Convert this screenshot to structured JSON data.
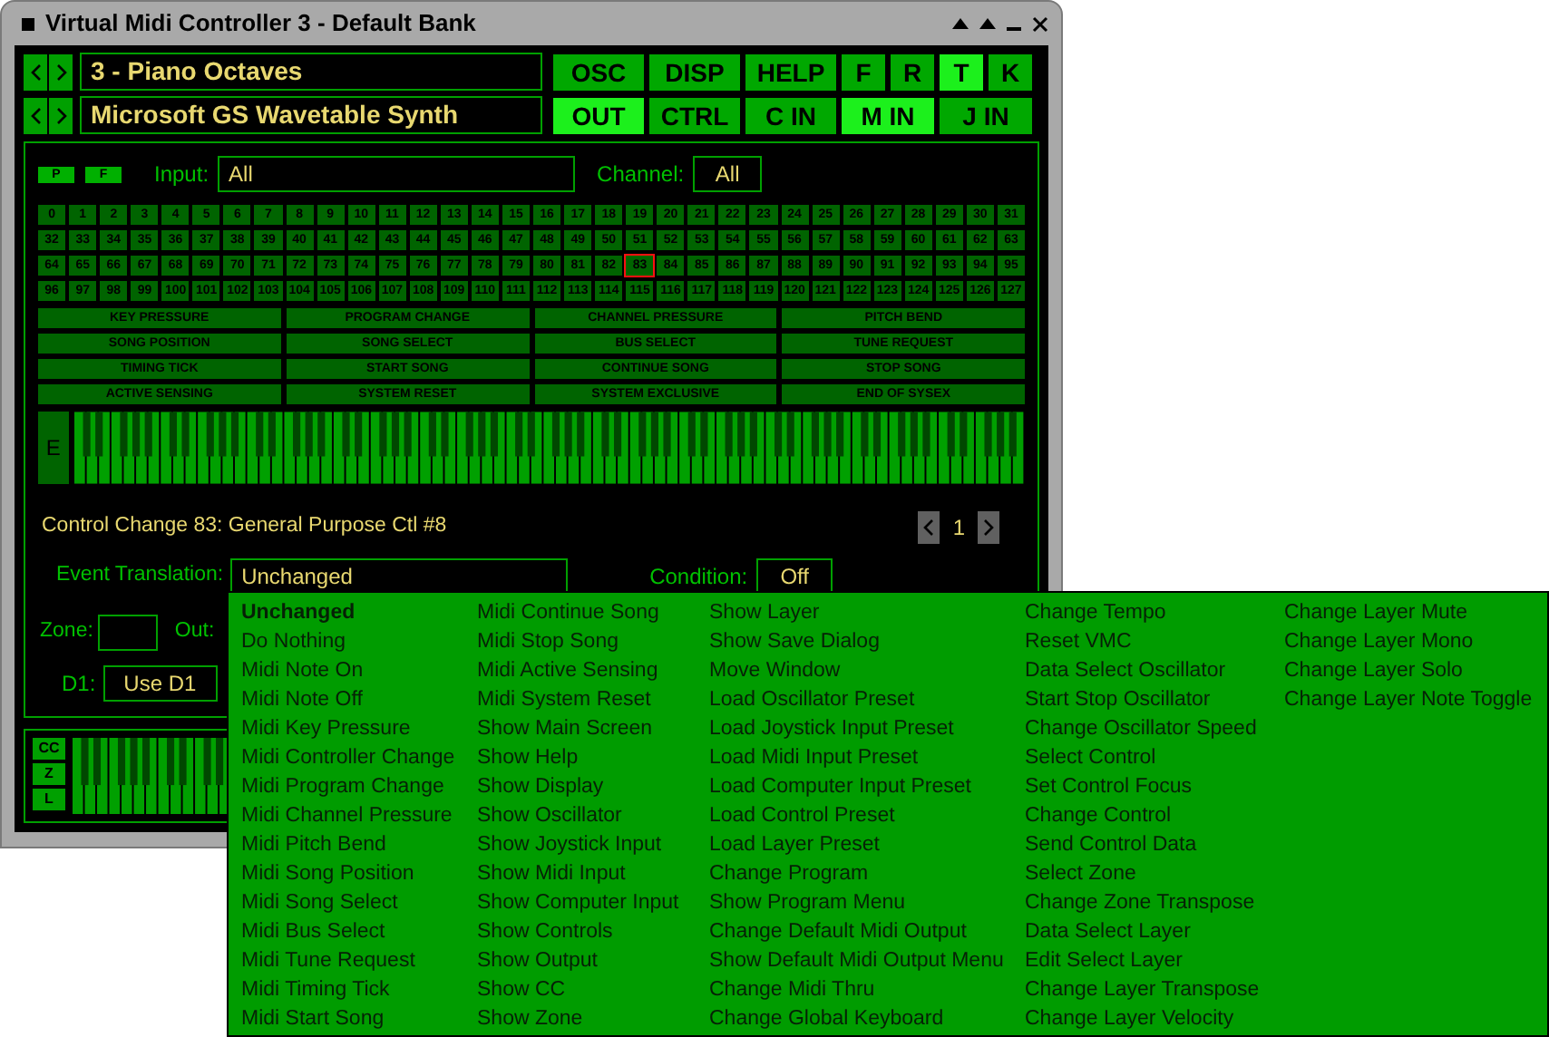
{
  "window": {
    "title": "Virtual Midi Controller 3 - Default Bank"
  },
  "selector_rows": [
    {
      "value": "3 - Piano Octaves",
      "buttons": [
        {
          "label": "OSC",
          "selected": false
        },
        {
          "label": "DISP",
          "selected": false
        },
        {
          "label": "HELP",
          "selected": false
        },
        {
          "label": "F",
          "selected": false
        },
        {
          "label": "R",
          "selected": false
        },
        {
          "label": "T",
          "selected": true
        },
        {
          "label": "K",
          "selected": false
        }
      ]
    },
    {
      "value": "Microsoft GS Wavetable Synth",
      "buttons": [
        {
          "label": "OUT",
          "selected": true
        },
        {
          "label": "CTRL",
          "selected": false
        },
        {
          "label": "C IN",
          "selected": false
        },
        {
          "label": "M IN",
          "selected": true
        },
        {
          "label": "J IN",
          "selected": false
        }
      ]
    }
  ],
  "filter": {
    "toggles": [
      "P",
      "F"
    ],
    "input_label": "Input:",
    "input_value": "All",
    "channel_label": "Channel:",
    "channel_value": "All"
  },
  "cc_buttons": [
    {
      "label": "0",
      "selected": false
    },
    {
      "label": "1",
      "selected": false
    },
    {
      "label": "2",
      "selected": false
    },
    {
      "label": "3",
      "selected": false
    },
    {
      "label": "4",
      "selected": false
    },
    {
      "label": "5",
      "selected": false
    },
    {
      "label": "6",
      "selected": false
    },
    {
      "label": "7",
      "selected": false
    },
    {
      "label": "8",
      "selected": false
    },
    {
      "label": "9",
      "selected": false
    },
    {
      "label": "10",
      "selected": false
    },
    {
      "label": "11",
      "selected": false
    },
    {
      "label": "12",
      "selected": false
    },
    {
      "label": "13",
      "selected": false
    },
    {
      "label": "14",
      "selected": false
    },
    {
      "label": "15",
      "selected": false
    },
    {
      "label": "16",
      "selected": false
    },
    {
      "label": "17",
      "selected": false
    },
    {
      "label": "18",
      "selected": false
    },
    {
      "label": "19",
      "selected": false
    },
    {
      "label": "20",
      "selected": false
    },
    {
      "label": "21",
      "selected": false
    },
    {
      "label": "22",
      "selected": false
    },
    {
      "label": "23",
      "selected": false
    },
    {
      "label": "24",
      "selected": false
    },
    {
      "label": "25",
      "selected": false
    },
    {
      "label": "26",
      "selected": false
    },
    {
      "label": "27",
      "selected": false
    },
    {
      "label": "28",
      "selected": false
    },
    {
      "label": "29",
      "selected": false
    },
    {
      "label": "30",
      "selected": false
    },
    {
      "label": "31",
      "selected": false
    },
    {
      "label": "32",
      "selected": false
    },
    {
      "label": "33",
      "selected": false
    },
    {
      "label": "34",
      "selected": false
    },
    {
      "label": "35",
      "selected": false
    },
    {
      "label": "36",
      "selected": false
    },
    {
      "label": "37",
      "selected": false
    },
    {
      "label": "38",
      "selected": false
    },
    {
      "label": "39",
      "selected": false
    },
    {
      "label": "40",
      "selected": false
    },
    {
      "label": "41",
      "selected": false
    },
    {
      "label": "42",
      "selected": false
    },
    {
      "label": "43",
      "selected": false
    },
    {
      "label": "44",
      "selected": false
    },
    {
      "label": "45",
      "selected": false
    },
    {
      "label": "46",
      "selected": false
    },
    {
      "label": "47",
      "selected": false
    },
    {
      "label": "48",
      "selected": false
    },
    {
      "label": "49",
      "selected": false
    },
    {
      "label": "50",
      "selected": false
    },
    {
      "label": "51",
      "selected": false
    },
    {
      "label": "52",
      "selected": false
    },
    {
      "label": "53",
      "selected": false
    },
    {
      "label": "54",
      "selected": false
    },
    {
      "label": "55",
      "selected": false
    },
    {
      "label": "56",
      "selected": false
    },
    {
      "label": "57",
      "selected": false
    },
    {
      "label": "58",
      "selected": false
    },
    {
      "label": "59",
      "selected": false
    },
    {
      "label": "60",
      "selected": false
    },
    {
      "label": "61",
      "selected": false
    },
    {
      "label": "62",
      "selected": false
    },
    {
      "label": "63",
      "selected": false
    },
    {
      "label": "64",
      "selected": false
    },
    {
      "label": "65",
      "selected": false
    },
    {
      "label": "66",
      "selected": false
    },
    {
      "label": "67",
      "selected": false
    },
    {
      "label": "68",
      "selected": false
    },
    {
      "label": "69",
      "selected": false
    },
    {
      "label": "70",
      "selected": false
    },
    {
      "label": "71",
      "selected": false
    },
    {
      "label": "72",
      "selected": false
    },
    {
      "label": "73",
      "selected": false
    },
    {
      "label": "74",
      "selected": false
    },
    {
      "label": "75",
      "selected": false
    },
    {
      "label": "76",
      "selected": false
    },
    {
      "label": "77",
      "selected": false
    },
    {
      "label": "78",
      "selected": false
    },
    {
      "label": "79",
      "selected": false
    },
    {
      "label": "80",
      "selected": false
    },
    {
      "label": "81",
      "selected": false
    },
    {
      "label": "82",
      "selected": false
    },
    {
      "label": "83",
      "selected": true
    },
    {
      "label": "84",
      "selected": false
    },
    {
      "label": "85",
      "selected": false
    },
    {
      "label": "86",
      "selected": false
    },
    {
      "label": "87",
      "selected": false
    },
    {
      "label": "88",
      "selected": false
    },
    {
      "label": "89",
      "selected": false
    },
    {
      "label": "90",
      "selected": false
    },
    {
      "label": "91",
      "selected": false
    },
    {
      "label": "92",
      "selected": false
    },
    {
      "label": "93",
      "selected": false
    },
    {
      "label": "94",
      "selected": false
    },
    {
      "label": "95",
      "selected": false
    },
    {
      "label": "96",
      "selected": false
    },
    {
      "label": "97",
      "selected": false
    },
    {
      "label": "98",
      "selected": false
    },
    {
      "label": "99",
      "selected": false
    },
    {
      "label": "100",
      "selected": false
    },
    {
      "label": "101",
      "selected": false
    },
    {
      "label": "102",
      "selected": false
    },
    {
      "label": "103",
      "selected": false
    },
    {
      "label": "104",
      "selected": false
    },
    {
      "label": "105",
      "selected": false
    },
    {
      "label": "106",
      "selected": false
    },
    {
      "label": "107",
      "selected": false
    },
    {
      "label": "108",
      "selected": false
    },
    {
      "label": "109",
      "selected": false
    },
    {
      "label": "110",
      "selected": false
    },
    {
      "label": "111",
      "selected": false
    },
    {
      "label": "112",
      "selected": false
    },
    {
      "label": "113",
      "selected": false
    },
    {
      "label": "114",
      "selected": false
    },
    {
      "label": "115",
      "selected": false
    },
    {
      "label": "116",
      "selected": false
    },
    {
      "label": "117",
      "selected": false
    },
    {
      "label": "118",
      "selected": false
    },
    {
      "label": "119",
      "selected": false
    },
    {
      "label": "120",
      "selected": false
    },
    {
      "label": "121",
      "selected": false
    },
    {
      "label": "122",
      "selected": false
    },
    {
      "label": "123",
      "selected": false
    },
    {
      "label": "124",
      "selected": false
    },
    {
      "label": "125",
      "selected": false
    },
    {
      "label": "126",
      "selected": false
    },
    {
      "label": "127",
      "selected": false
    }
  ],
  "message_buttons": [
    "KEY PRESSURE",
    "PROGRAM CHANGE",
    "CHANNEL PRESSURE",
    "PITCH BEND",
    "SONG POSITION",
    "SONG SELECT",
    "BUS SELECT",
    "TUNE REQUEST",
    "TIMING TICK",
    "START SONG",
    "CONTINUE SONG",
    "STOP SONG",
    "ACTIVE SENSING",
    "SYSTEM RESET",
    "SYSTEM EXCLUSIVE",
    "END OF SYSEX"
  ],
  "keyboard": {
    "button": "E"
  },
  "status": {
    "text": "Control Change 83: General Purpose Ctl #8",
    "page": "1"
  },
  "event_translation": {
    "label": "Event Translation:",
    "value": "Unchanged",
    "condition_label": "Condition:",
    "condition_value": "Off"
  },
  "zone": {
    "label": "Zone:",
    "out_label": "Out:"
  },
  "d1": {
    "label": "D1:",
    "button": "Use D1"
  },
  "layer_buttons": [
    "CC",
    "Z",
    "L"
  ],
  "translation_menu": [
    [
      {
        "label": "Unchanged",
        "selected": true
      },
      {
        "label": "Do Nothing",
        "selected": false
      },
      {
        "label": "Midi Note On",
        "selected": false
      },
      {
        "label": "Midi Note Off",
        "selected": false
      },
      {
        "label": "Midi Key Pressure",
        "selected": false
      },
      {
        "label": "Midi Controller Change",
        "selected": false
      },
      {
        "label": "Midi Program Change",
        "selected": false
      },
      {
        "label": "Midi Channel Pressure",
        "selected": false
      },
      {
        "label": "Midi Pitch Bend",
        "selected": false
      },
      {
        "label": "Midi Song Position",
        "selected": false
      },
      {
        "label": "Midi Song Select",
        "selected": false
      },
      {
        "label": "Midi Bus Select",
        "selected": false
      },
      {
        "label": "Midi Tune Request",
        "selected": false
      },
      {
        "label": "Midi Timing Tick",
        "selected": false
      },
      {
        "label": "Midi Start Song",
        "selected": false
      }
    ],
    [
      {
        "label": "Midi Continue Song",
        "selected": false
      },
      {
        "label": "Midi Stop Song",
        "selected": false
      },
      {
        "label": "Midi Active Sensing",
        "selected": false
      },
      {
        "label": "Midi System Reset",
        "selected": false
      },
      {
        "label": "Show Main Screen",
        "selected": false
      },
      {
        "label": "Show Help",
        "selected": false
      },
      {
        "label": "Show Display",
        "selected": false
      },
      {
        "label": "Show Oscillator",
        "selected": false
      },
      {
        "label": "Show Joystick Input",
        "selected": false
      },
      {
        "label": "Show Midi Input",
        "selected": false
      },
      {
        "label": "Show Computer Input",
        "selected": false
      },
      {
        "label": "Show Controls",
        "selected": false
      },
      {
        "label": "Show Output",
        "selected": false
      },
      {
        "label": "Show CC",
        "selected": false
      },
      {
        "label": "Show Zone",
        "selected": false
      }
    ],
    [
      {
        "label": "Show Layer",
        "selected": false
      },
      {
        "label": "Show Save Dialog",
        "selected": false
      },
      {
        "label": "Move Window",
        "selected": false
      },
      {
        "label": "Load Oscillator Preset",
        "selected": false
      },
      {
        "label": "Load Joystick Input Preset",
        "selected": false
      },
      {
        "label": "Load Midi Input Preset",
        "selected": false
      },
      {
        "label": "Load Computer Input Preset",
        "selected": false
      },
      {
        "label": "Load Control Preset",
        "selected": false
      },
      {
        "label": "Load Layer Preset",
        "selected": false
      },
      {
        "label": "Change Program",
        "selected": false
      },
      {
        "label": "Show Program Menu",
        "selected": false
      },
      {
        "label": "Change Default Midi Output",
        "selected": false
      },
      {
        "label": "Show Default Midi Output Menu",
        "selected": false
      },
      {
        "label": "Change Midi Thru",
        "selected": false
      },
      {
        "label": "Change Global Keyboard",
        "selected": false
      }
    ],
    [
      {
        "label": "Change Tempo",
        "selected": false
      },
      {
        "label": "Reset VMC",
        "selected": false
      },
      {
        "label": "Data Select Oscillator",
        "selected": false
      },
      {
        "label": "Start Stop Oscillator",
        "selected": false
      },
      {
        "label": "Change Oscillator Speed",
        "selected": false
      },
      {
        "label": "Select Control",
        "selected": false
      },
      {
        "label": "Set Control Focus",
        "selected": false
      },
      {
        "label": "Change Control",
        "selected": false
      },
      {
        "label": "Send Control Data",
        "selected": false
      },
      {
        "label": "Select Zone",
        "selected": false
      },
      {
        "label": "Change Zone Transpose",
        "selected": false
      },
      {
        "label": "Data Select Layer",
        "selected": false
      },
      {
        "label": "Edit Select Layer",
        "selected": false
      },
      {
        "label": "Change Layer Transpose",
        "selected": false
      },
      {
        "label": "Change Layer Velocity",
        "selected": false
      }
    ],
    [
      {
        "label": "Change Layer Mute",
        "selected": false
      },
      {
        "label": "Change Layer Mono",
        "selected": false
      },
      {
        "label": "Change Layer Solo",
        "selected": false
      },
      {
        "label": "Change Layer Note Toggle",
        "selected": false
      }
    ]
  ]
}
